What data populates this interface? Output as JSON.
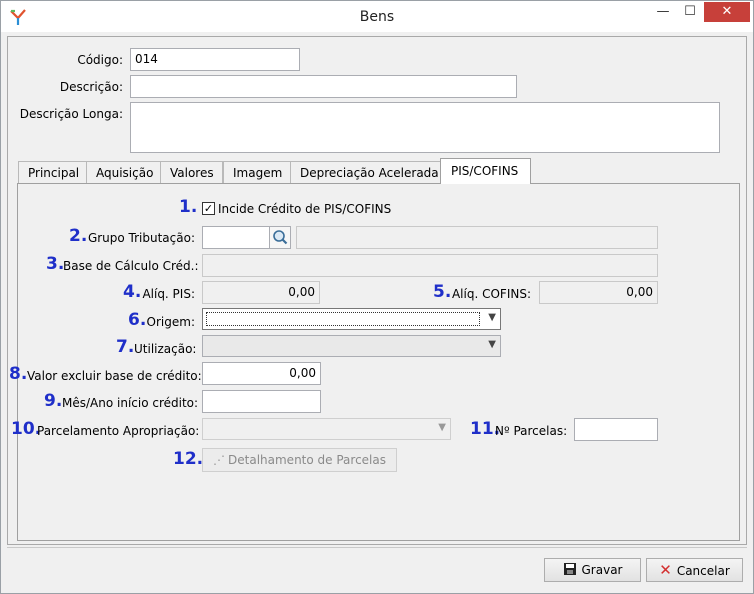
{
  "window": {
    "title": "Bens",
    "minimize": "—",
    "maximize": "☐",
    "close": "✕"
  },
  "form": {
    "codigo": {
      "label": "Código:",
      "value": "014"
    },
    "descricao": {
      "label": "Descrição:",
      "value": ""
    },
    "descricao_longa": {
      "label": "Descrição Longa:",
      "value": ""
    }
  },
  "tabs": [
    {
      "label": "Principal"
    },
    {
      "label": "Aquisição"
    },
    {
      "label": "Valores"
    },
    {
      "label": "Imagem"
    },
    {
      "label": "Depreciação Acelerada"
    },
    {
      "label": "PIS/COFINS",
      "active": true
    }
  ],
  "pis": {
    "n1": "1.",
    "incide_label": "Incide Crédito de PIS/COFINS",
    "incide_checked": true,
    "check_mark": "✓",
    "n2": "2.",
    "grupo_label": "Grupo Tributação:",
    "grupo_code": "",
    "grupo_desc": "",
    "n3": "3.",
    "base_label": "Base de Cálculo Créd.:",
    "base_value": "",
    "n4": "4.",
    "aliq_pis_label": "Alíq. PIS:",
    "aliq_pis_value": "0,00",
    "n5": "5.",
    "aliq_cofins_label": "Alíq. COFINS:",
    "aliq_cofins_value": "0,00",
    "n6": "6.",
    "origem_label": "Origem:",
    "origem_value": "",
    "n7": "7.",
    "utilizacao_label": "Utilização:",
    "utilizacao_value": "",
    "n8": "8.",
    "valor_excluir_label": "Valor excluir base de crédito:",
    "valor_excluir_value": "0,00",
    "n9": "9.",
    "mes_ano_label": "Mês/Ano início crédito:",
    "mes_ano_value": "",
    "n10": "10.",
    "parcelamento_label": "Parcelamento Apropriação:",
    "parcelamento_value": "",
    "n11": "11.",
    "n_parcelas_label": "Nº Parcelas:",
    "n_parcelas_value": "",
    "n12": "12.",
    "detalhamento_label": "Detalhamento de Parcelas"
  },
  "footer": {
    "gravar": "Gravar",
    "cancelar": "Cancelar"
  },
  "colors": {
    "accent_number": "#1f2fc9",
    "close_button": "#c7403a"
  }
}
